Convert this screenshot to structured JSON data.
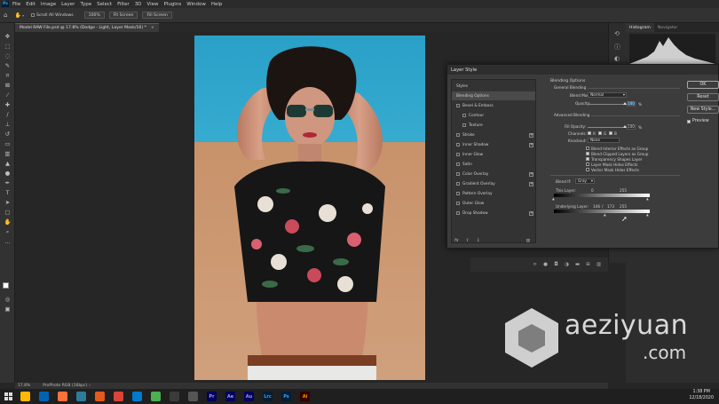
{
  "menubar": {
    "logo": "Ps",
    "items": [
      "File",
      "Edit",
      "Image",
      "Layer",
      "Type",
      "Select",
      "Filter",
      "3D",
      "View",
      "Plugins",
      "Window",
      "Help"
    ]
  },
  "options": {
    "scroll_all_label": "Scroll All Windows",
    "zoom_value": "100%",
    "fit_label": "Fit Screen",
    "fill_label": "Fill Screen"
  },
  "document": {
    "tab_title": "Model RAW File.psd @ 17.8% (Dodge - Light, Layer Mask/16) *",
    "zoom_status": "17.8%",
    "profile_status": "ProPhoto RGB (16bpc)"
  },
  "right_panel": {
    "tabs": [
      "Histogram",
      "Navigator"
    ]
  },
  "dialog": {
    "title": "Layer Style",
    "styles_header": "Styles",
    "styles": [
      {
        "label": "Blending Options",
        "checkbox": false,
        "plus": false,
        "selected": true,
        "indent": false
      },
      {
        "label": "Bevel & Emboss",
        "checkbox": true,
        "plus": false,
        "selected": false,
        "indent": false
      },
      {
        "label": "Contour",
        "checkbox": true,
        "plus": false,
        "selected": false,
        "indent": true
      },
      {
        "label": "Texture",
        "checkbox": true,
        "plus": false,
        "selected": false,
        "indent": true
      },
      {
        "label": "Stroke",
        "checkbox": true,
        "plus": true,
        "selected": false,
        "indent": false
      },
      {
        "label": "Inner Shadow",
        "checkbox": true,
        "plus": true,
        "selected": false,
        "indent": false
      },
      {
        "label": "Inner Glow",
        "checkbox": true,
        "plus": false,
        "selected": false,
        "indent": false
      },
      {
        "label": "Satin",
        "checkbox": true,
        "plus": false,
        "selected": false,
        "indent": false
      },
      {
        "label": "Color Overlay",
        "checkbox": true,
        "plus": true,
        "selected": false,
        "indent": false
      },
      {
        "label": "Gradient Overlay",
        "checkbox": true,
        "plus": true,
        "selected": false,
        "indent": false
      },
      {
        "label": "Pattern Overlay",
        "checkbox": true,
        "plus": false,
        "selected": false,
        "indent": false
      },
      {
        "label": "Outer Glow",
        "checkbox": true,
        "plus": false,
        "selected": false,
        "indent": false
      },
      {
        "label": "Drop Shadow",
        "checkbox": true,
        "plus": true,
        "selected": false,
        "indent": false
      }
    ],
    "fx_label": "fx",
    "blending": {
      "section_title": "Blending Options",
      "general_title": "General Blending",
      "blend_mode_label": "Blend Mode:",
      "blend_mode_value": "Normal",
      "opacity_label": "Opacity:",
      "opacity_value": "100",
      "opacity_fraction": 1.0,
      "advanced_title": "Advanced Blending",
      "fill_opacity_label": "Fill Opacity:",
      "fill_opacity_value": "100",
      "fill_opacity_fraction": 1.0,
      "channels_label": "Channels:",
      "channels": [
        "R",
        "G",
        "B"
      ],
      "knockout_label": "Knockout:",
      "knockout_value": "None",
      "options": [
        {
          "label": "Blend Interior Effects as Group",
          "checked": false
        },
        {
          "label": "Blend Clipped Layers as Group",
          "checked": true
        },
        {
          "label": "Transparency Shapes Layer",
          "checked": true
        },
        {
          "label": "Layer Mask Hides Effects",
          "checked": false
        },
        {
          "label": "Vector Mask Hides Effects",
          "checked": false
        }
      ],
      "blend_if_label": "Blend If:",
      "blend_if_value": "Gray",
      "this_layer_label": "This Layer:",
      "this_layer_values": [
        "0",
        "255"
      ],
      "underlying_label": "Underlying Layer:",
      "underlying_values": [
        "146",
        "/",
        "173",
        "255"
      ],
      "percent": "%"
    },
    "buttons": [
      "OK",
      "Reset",
      "New Style...",
      "Preview"
    ]
  },
  "taskbar": {
    "apps": [
      {
        "label": "",
        "color": "#ffb900",
        "fg": "#000"
      },
      {
        "label": "",
        "color": "#0063b1",
        "fg": "#fff"
      },
      {
        "label": "",
        "color": "#ff7139",
        "fg": "#fff"
      },
      {
        "label": "",
        "color": "#2d7d9a",
        "fg": "#fff"
      },
      {
        "label": "",
        "color": "#e25a1c",
        "fg": "#fff"
      },
      {
        "label": "",
        "color": "#db4437",
        "fg": "#fff"
      },
      {
        "label": "",
        "color": "#007acc",
        "fg": "#fff"
      },
      {
        "label": "",
        "color": "#4caf50",
        "fg": "#fff"
      },
      {
        "label": "",
        "color": "#3b3b3b",
        "fg": "#fff"
      },
      {
        "label": "",
        "color": "#555555",
        "fg": "#fff"
      },
      {
        "label": "Pr",
        "color": "#00005b",
        "fg": "#9999ff"
      },
      {
        "label": "Ae",
        "color": "#00005b",
        "fg": "#9999ff"
      },
      {
        "label": "Au",
        "color": "#00005b",
        "fg": "#9999ff"
      },
      {
        "label": "Lrc",
        "color": "#001e36",
        "fg": "#31a8ff"
      },
      {
        "label": "Ps",
        "color": "#001e36",
        "fg": "#31a8ff"
      },
      {
        "label": "Ai",
        "color": "#330000",
        "fg": "#ff9a00"
      }
    ],
    "time": "1:38 PM",
    "date": "12/18/2020"
  },
  "watermark": {
    "text": "aeziyuan",
    "sub": ".com"
  },
  "colors": {
    "sky": "#2b9ac0",
    "sand": "#c99a74",
    "accent_blue": "#2b5a8f"
  }
}
